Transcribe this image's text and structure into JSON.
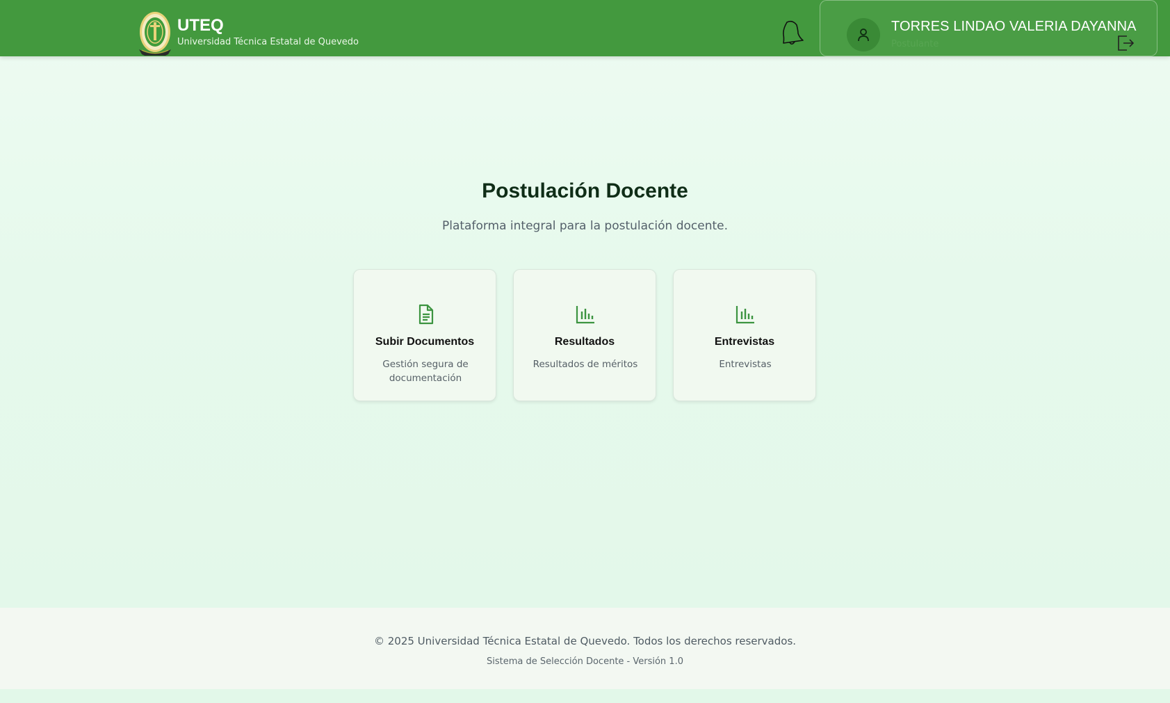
{
  "header": {
    "brand_title": "UTEQ",
    "brand_subtitle": "Universidad Técnica Estatal de Quevedo",
    "user_name": "TORRES LINDAO VALERIA DAYANNA",
    "user_role": "Postulante",
    "icons": [
      "university-logo",
      "bell-icon",
      "user-icon",
      "logout-icon"
    ],
    "bar_color": "#43993e"
  },
  "main": {
    "title": "Postulación Docente",
    "subtitle": "Plataforma integral para la postulación  docente.",
    "cards": [
      {
        "icon": "document-icon",
        "title": "Subir Documentos",
        "description": "Gestión segura de documentación"
      },
      {
        "icon": "bar-chart-icon",
        "title": "Resultados",
        "description": "Resultados de méritos"
      },
      {
        "icon": "bar-chart-icon",
        "title": "Entrevistas",
        "description": "Entrevistas"
      }
    ],
    "accent_color": "#3c9440"
  },
  "footer": {
    "copyright": "© 2025 Universidad Técnica Estatal de Quevedo. Todos los derechos reservados.",
    "version": "Sistema de Selección Docente - Versión 1.0"
  }
}
